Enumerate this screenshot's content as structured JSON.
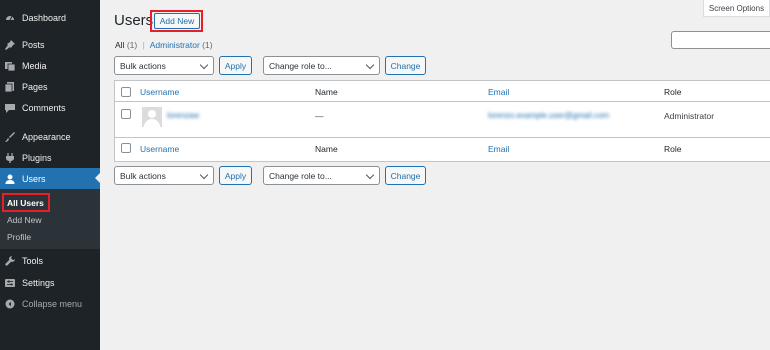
{
  "sidebar": {
    "items": [
      {
        "label": "Dashboard",
        "icon": "dashboard-icon"
      },
      {
        "label": "Posts",
        "icon": "pin-icon"
      },
      {
        "label": "Media",
        "icon": "media-icon"
      },
      {
        "label": "Pages",
        "icon": "pages-icon"
      },
      {
        "label": "Comments",
        "icon": "comment-icon"
      },
      {
        "label": "Appearance",
        "icon": "brush-icon"
      },
      {
        "label": "Plugins",
        "icon": "plug-icon"
      },
      {
        "label": "Users",
        "icon": "user-icon"
      },
      {
        "label": "Tools",
        "icon": "wrench-icon"
      },
      {
        "label": "Settings",
        "icon": "settings-icon"
      },
      {
        "label": "Collapse menu",
        "icon": "collapse-icon"
      }
    ],
    "submenu": [
      "All Users",
      "Add New",
      "Profile"
    ]
  },
  "page": {
    "title": "Users",
    "add_new": "Add New",
    "screen_options": "Screen Options"
  },
  "views": {
    "all": "All",
    "all_count": "(1)",
    "separator": "|",
    "admin": "Administrator",
    "admin_count": "(1)"
  },
  "bulk_top": {
    "bulk": "Bulk actions",
    "apply": "Apply",
    "role": "Change role to...",
    "change": "Change"
  },
  "bulk_bottom": {
    "bulk": "Bulk actions",
    "apply": "Apply",
    "role": "Change role to...",
    "change": "Change"
  },
  "table": {
    "columns": [
      "Username",
      "Name",
      "Email",
      "Role"
    ],
    "rows": [
      {
        "username": "lorenzaw",
        "name": "—",
        "email": "lorenzo.example.user@gmail.com",
        "role": "Administrator"
      }
    ]
  },
  "colors": {
    "sidebar": "#1d2327",
    "accent": "#2271b1",
    "highlight": "#e5202a"
  }
}
